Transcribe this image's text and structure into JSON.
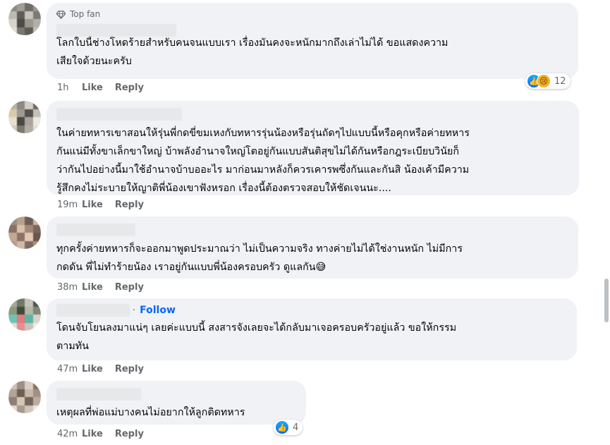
{
  "actions": {
    "like": "Like",
    "reply": "Reply",
    "follow": "Follow"
  },
  "comments": [
    {
      "badge": "Top fan",
      "text": "โลกใบนี้ช่างโหดร้ายสำหรับคนจนแบบเรา เรื่องมันคงจะหนักมากถึงเล่าไม่ได้ ขอแสดงความ\nเสียใจด้วยนะครับ",
      "time": "1h",
      "reactions": {
        "types": [
          "like",
          "sad"
        ],
        "count": "12"
      }
    },
    {
      "text": "ในค่ายทหารเขาสอนให้รุ่นพี่กดขี่ขมเหงกับทหารรุ่นน้องหรือรุ่นถัดๆไปแบบนี้หรือคุกหรือค่ายทหาร\nกันแน่มีทั้งขาเล็กขาใหญ่ บ้าพลังอำนาจใหญ่โตอยู่กันแบบสันติสุขไม่ได้กันหรือกฎระเบียบวินัยก็\nว่ากันไปอย่างนี้มาใช้อำนาจบ้าบออะไร มาก่อนมาหลังก็ควรเคารพซึ่งกันและกันสิ น้องเค้ามีความ\nรู้สึกคงไม่ระบายให้ญาติพี่น้องเขาฟังหรอก เรื่องนี้ต้องตรวจสอบให้ชัดเจนนะ....",
      "time": "19m"
    },
    {
      "text": "ทุกครั้งค่ายทหารก็จะออกมาพูดประมาณว่า ไม่เป็นความจริง ทางค่ายไม่ได้ใช่งานหนัก ไม่มีการ\nกดดัน พี่ไม่ทำร้ายน้อง เราอยู่กันแบบพี่น้องครอบครัว ดูแลกัน😅",
      "time": "38m"
    },
    {
      "follow_sep": "·",
      "text": "โดนจับโยนลงมาแน่ๆ เลยค่ะแบบนี้ สงสารจังเลยจะได้กลับมาเจอครอบครัวอยู่แล้ว ขอให้กรรม\nตามทัน",
      "time": "47m"
    },
    {
      "text": "เหตุผลที่พ่อแม่บางคนไม่อยากให้ลูกติดทหาร",
      "time": "42m",
      "reactions": {
        "types": [
          "like"
        ],
        "count": "4"
      }
    }
  ]
}
